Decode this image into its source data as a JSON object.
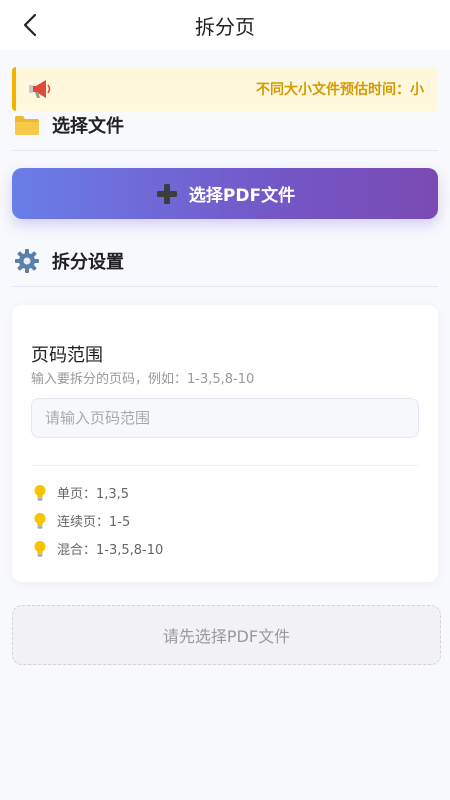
{
  "header": {
    "title": "拆分页",
    "back_icon": "chevron-left-icon"
  },
  "notice": {
    "icon": "megaphone-icon",
    "text": "不同大小文件预估时间：小"
  },
  "file_section": {
    "icon": "folder-icon",
    "title": "选择文件",
    "select_button": {
      "icon": "plus-icon",
      "label": "选择PDF文件"
    }
  },
  "settings_section": {
    "icon": "gear-icon",
    "title": "拆分设置",
    "page_range": {
      "title": "页码范围",
      "hint": "输入要拆分的页码，例如：1-3,5,8-10",
      "placeholder": "请输入页码范围",
      "value": ""
    },
    "tips": [
      {
        "icon": "lightbulb-icon",
        "text": "单页：1,3,5"
      },
      {
        "icon": "lightbulb-icon",
        "text": "连续页：1-5"
      },
      {
        "icon": "lightbulb-icon",
        "text": "混合：1-3,5,8-10"
      }
    ]
  },
  "action": {
    "label": "请先选择PDF文件",
    "enabled": false
  },
  "colors": {
    "accent_start": "#6a7ee8",
    "accent_end": "#7a4ab4",
    "notice_bg": "#fff8dc",
    "notice_border": "#f0b400",
    "notice_text": "#d49a00"
  }
}
